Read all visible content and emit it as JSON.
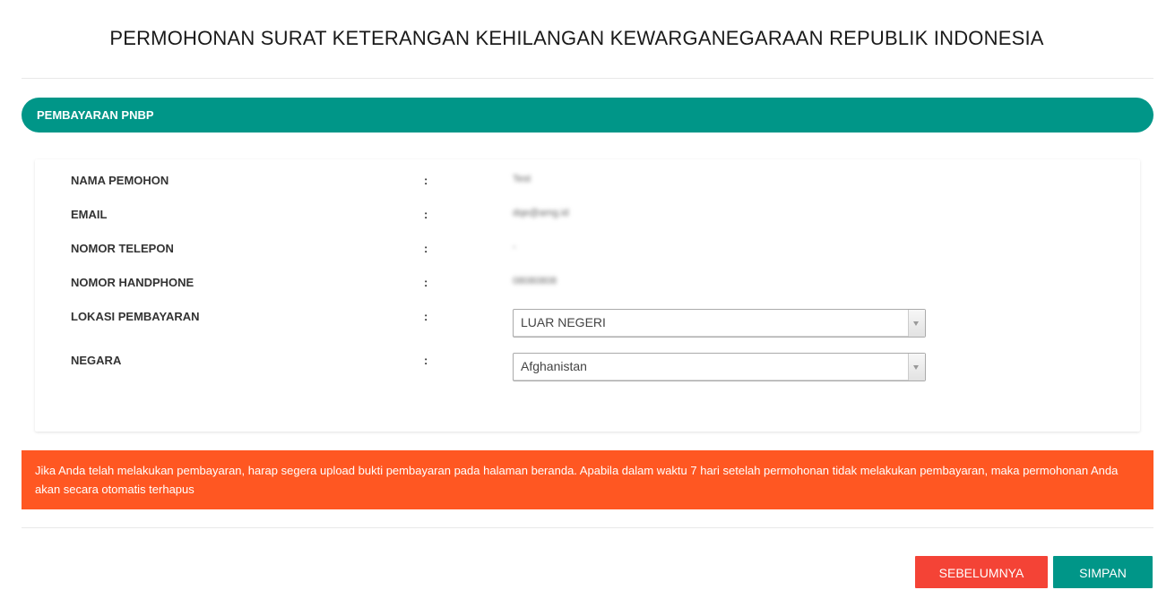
{
  "page": {
    "title": "PERMOHONAN SURAT KETERANGAN KEHILANGAN KEWARGANEGARAAN REPUBLIK INDONESIA"
  },
  "section": {
    "title": "PEMBAYARAN PNBP"
  },
  "form": {
    "separator": ":",
    "rows": [
      {
        "label": "NAMA PEMOHON",
        "value": "Test"
      },
      {
        "label": "EMAIL",
        "value": "dqe@amg.id"
      },
      {
        "label": "NOMOR TELEPON",
        "value": "-"
      },
      {
        "label": "NOMOR HANDPHONE",
        "value": "08080808"
      }
    ],
    "lokasi": {
      "label": "LOKASI PEMBAYARAN",
      "selected": "LUAR NEGERI"
    },
    "negara": {
      "label": "NEGARA",
      "selected": "Afghanistan"
    }
  },
  "notice": {
    "text": "Jika Anda telah melakukan pembayaran, harap segera upload bukti pembayaran pada halaman beranda. Apabila dalam waktu 7 hari setelah permohonan tidak melakukan pembayaran, maka permohonan Anda akan secara otomatis terhapus"
  },
  "buttons": {
    "previous": "SEBELUMNYA",
    "save": "SIMPAN"
  },
  "colors": {
    "primary": "#009688",
    "warning": "#ff5722",
    "danger": "#f44336"
  }
}
